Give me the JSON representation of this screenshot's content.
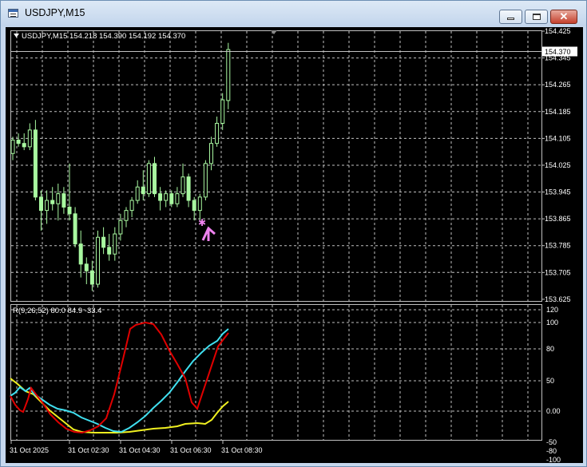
{
  "window": {
    "title": "USDJPY,M15",
    "controls": {
      "minimize": "minimize",
      "maximize": "maximize",
      "close": "close"
    }
  },
  "main_chart": {
    "header": "USDJPY,M15  154.218 154.390 154.192 154.370",
    "price_labels": [
      "154.425",
      "154.345",
      "154.265",
      "154.185",
      "154.105",
      "154.025",
      "153.945",
      "153.865",
      "153.785",
      "153.705",
      "153.625"
    ],
    "current_price": "154.370",
    "price_range": [
      153.62,
      154.425
    ],
    "colors": {
      "background": "#000000",
      "grid": "#c0c0c0",
      "candles": "#a8f8a0",
      "arrow": "#ee82ee",
      "price_line": "#c0c0c0"
    }
  },
  "indicator": {
    "header": "R(9,26,52) 80.0 84.9 -33.4",
    "scale_labels": [
      "120",
      "100",
      "80",
      "50",
      "0.00",
      "-50",
      "-80",
      "-100"
    ],
    "colors": {
      "red": "#e00000",
      "cyan": "#40e0f0",
      "yellow": "#f0f020"
    }
  },
  "time_axis": {
    "labels": [
      "31 Oct 2025",
      "31 Oct 02:30",
      "31 Oct 04:30",
      "31 Oct 06:30",
      "31 Oct 08:30"
    ]
  },
  "chart_data": {
    "type": "candlestick",
    "symbol": "USDJPY",
    "timeframe": "M15",
    "last_bar": {
      "open": 154.218,
      "high": 154.39,
      "low": 154.192,
      "close": 154.37
    },
    "y_axis_range": [
      153.62,
      154.425
    ],
    "candles": [
      [
        154.06,
        154.11,
        154.04,
        154.1
      ],
      [
        154.1,
        154.12,
        154.08,
        154.09
      ],
      [
        154.09,
        154.12,
        154.07,
        154.08
      ],
      [
        154.08,
        154.15,
        154.07,
        154.13
      ],
      [
        154.13,
        154.16,
        153.92,
        153.93
      ],
      [
        153.93,
        153.95,
        153.83,
        153.89
      ],
      [
        153.89,
        153.95,
        153.85,
        153.92
      ],
      [
        153.92,
        153.96,
        153.89,
        153.91
      ],
      [
        153.91,
        153.97,
        153.86,
        153.94
      ],
      [
        153.94,
        153.96,
        153.88,
        153.9
      ],
      [
        153.9,
        154.03,
        153.86,
        153.88
      ],
      [
        153.88,
        153.9,
        153.78,
        153.79
      ],
      [
        153.79,
        153.83,
        153.69,
        153.73
      ],
      [
        153.73,
        153.75,
        153.67,
        153.71
      ],
      [
        153.71,
        153.74,
        153.65,
        153.67
      ],
      [
        153.67,
        153.83,
        153.66,
        153.81
      ],
      [
        153.81,
        153.84,
        153.76,
        153.78
      ],
      [
        153.78,
        153.82,
        153.74,
        153.76
      ],
      [
        153.76,
        153.84,
        153.74,
        153.82
      ],
      [
        153.82,
        153.88,
        153.8,
        153.86
      ],
      [
        153.86,
        153.9,
        153.84,
        153.89
      ],
      [
        153.89,
        153.93,
        153.87,
        153.92
      ],
      [
        153.92,
        153.98,
        153.91,
        153.96
      ],
      [
        153.96,
        154.01,
        153.92,
        153.94
      ],
      [
        153.94,
        154.04,
        153.93,
        154.03
      ],
      [
        154.03,
        154.05,
        153.93,
        153.94
      ],
      [
        153.94,
        153.96,
        153.89,
        153.92
      ],
      [
        153.92,
        153.95,
        153.9,
        153.94
      ],
      [
        153.94,
        153.95,
        153.9,
        153.91
      ],
      [
        153.91,
        153.96,
        153.9,
        153.94
      ],
      [
        153.94,
        154.03,
        153.93,
        153.99
      ],
      [
        153.99,
        154.0,
        153.9,
        153.92
      ],
      [
        153.92,
        153.93,
        153.86,
        153.89
      ],
      [
        153.89,
        153.94,
        153.86,
        153.93
      ],
      [
        153.93,
        154.04,
        153.92,
        154.03
      ],
      [
        154.03,
        154.11,
        154.01,
        154.09
      ],
      [
        154.09,
        154.17,
        154.08,
        154.15
      ],
      [
        154.15,
        154.24,
        154.13,
        154.22
      ],
      [
        154.218,
        154.39,
        154.192,
        154.37
      ]
    ]
  }
}
